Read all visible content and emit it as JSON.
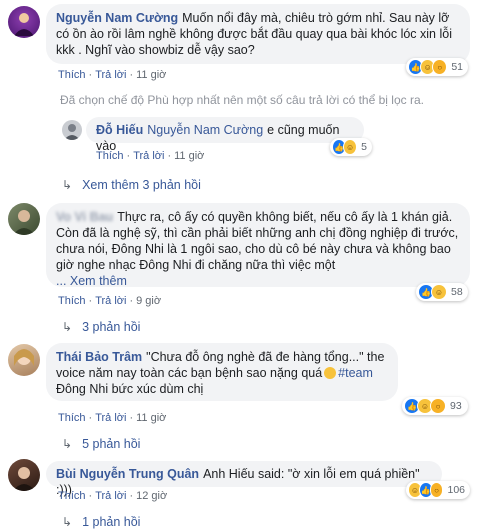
{
  "comments": [
    {
      "author": "Nguyễn Nam Cường",
      "text": "Muốn nổi đây mà, chiêu trò gớm nhỉ. Sau này lỡ có ồn ào rồi lâm nghề không được bắt đầu quay qua bài khóc lóc xin lỗi kkk . Nghĩ vào showbiz dễ vậy sao?",
      "like_label": "Thích",
      "reply_label": "Trả lời",
      "time": "11 giờ",
      "reaction_count": "51",
      "reaction_icons": [
        "like-icon",
        "haha-icon",
        "wow-icon"
      ]
    },
    {
      "author": "Vo Vi Bau",
      "text": "Thực ra, cô ấy có quyền không biết, nếu cô ấy là 1 khán giả. Còn đã là nghệ sỹ, thì cần phải biết những anh chị đồng nghiệp đi trước, chưa nói, Đông Nhi là 1 ngôi sao, cho dù cô bé này chưa và không bao giờ nghe nhạc Đông Nhi đi chăng nữa thì việc một",
      "see_more": "... Xem thêm",
      "like_label": "Thích",
      "reply_label": "Trả lời",
      "time": "9 giờ",
      "reaction_count": "58",
      "replies_label": "3 phản hồi"
    },
    {
      "author": "Thái Bảo Trâm",
      "text": "\"Chưa đỗ ông nghè đã đe hàng tổng...\" the voice năm nay toàn các bạn bệnh sao nặng quá",
      "hashtag": "#team",
      "text_tail": "Đông Nhi bức xúc dùm chị",
      "like_label": "Thích",
      "reply_label": "Trả lời",
      "time": "11 giờ",
      "reaction_count": "93",
      "replies_label": "5 phản hồi"
    },
    {
      "author": "Bùi Nguyễn Trung Quân",
      "text": "Anh Hiếu said: \"ờ xin lỗi em quá phiền\" :)))",
      "like_label": "Thích",
      "reply_label": "Trả lời",
      "time": "12 giờ",
      "reaction_count": "106",
      "replies_label": "1 phản hồi"
    }
  ],
  "filter_note": "Đã chọn chế độ Phù hợp nhất nên một số câu trả lời có thể bị lọc ra.",
  "reply": {
    "author": "Đỗ Hiếu",
    "mention": "Nguyễn Nam Cường",
    "text": "e cũng muốn vào",
    "like_label": "Thích",
    "reply_label": "Trả lời",
    "time": "11 giờ",
    "reaction_count": "5"
  },
  "see_more_replies": "Xem thêm 3 phản hồi",
  "colors": {
    "link": "#385898",
    "bubble": "#f2f3f5",
    "meta": "#606770",
    "like": "#1877f2",
    "haha": "#f7c23b"
  }
}
